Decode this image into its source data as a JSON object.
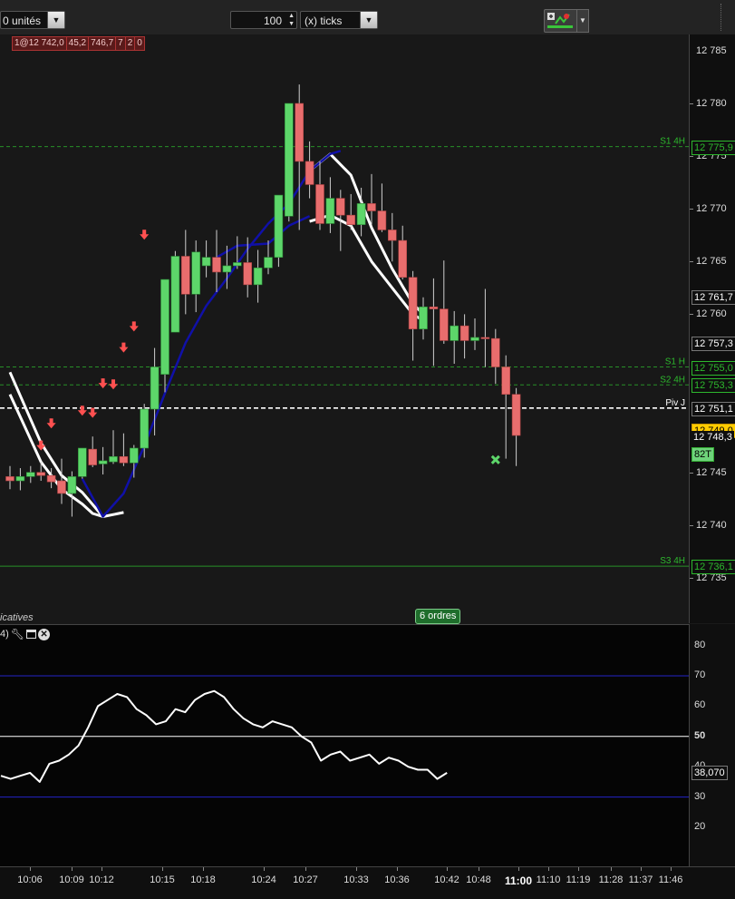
{
  "toolbar": {
    "units_value": "0 unités",
    "ticks_amount": "100",
    "ticks_unit": "(x) ticks"
  },
  "chart": {
    "order_ticket": [
      "1@12 742,0",
      "45,2",
      "746,7",
      "7",
      "2",
      "0"
    ],
    "price_labels": [
      "12 780",
      "12 775",
      "12 770",
      "12 765",
      "12 760",
      "12 745",
      "12 740",
      "12 735"
    ],
    "levels": [
      {
        "label": "S1 4H",
        "value": "12 775,9",
        "color": "#2db82d",
        "style": "dashed"
      },
      {
        "label": "S1 H",
        "value": "12 755,0",
        "color": "#2db82d",
        "style": "dashed"
      },
      {
        "label": "S2 4H",
        "value": "12 753,3",
        "color": "#2db82d",
        "style": "dashed"
      },
      {
        "label": "Piv J",
        "value": "12 751,1",
        "color": "#ffffff",
        "style": "dashed"
      },
      {
        "label": "S3 4H",
        "value": "12 736,1",
        "color": "#2db82d",
        "style": "solid"
      }
    ],
    "top_price": "12 785",
    "high_marker": "12 761,7",
    "mid_marker": "12 757,3",
    "last_price": "12 749,0",
    "last_price_color": "#ffcc00",
    "bid_price": "12 748,3",
    "ticks_badge": "82T",
    "orders_button": "6 ordres",
    "indicators_label": "icatives",
    "candles": [
      [
        0,
        12744.6,
        12745.6,
        12743.4,
        12744.2
      ],
      [
        1,
        12744.2,
        12745.4,
        12743.3,
        12744.6
      ],
      [
        2,
        12744.6,
        12745.6,
        12744.0,
        12745.0
      ],
      [
        3,
        12745.0,
        12746.0,
        12744.2,
        12744.7
      ],
      [
        4,
        12744.7,
        12745.4,
        12743.5,
        12744.1
      ],
      [
        5,
        12744.2,
        12746.3,
        12742.0,
        12743.0
      ],
      [
        6,
        12743.0,
        12745.1,
        12740.8,
        12744.6
      ],
      [
        7,
        12744.6,
        12747.2,
        12744.4,
        12747.3
      ],
      [
        8,
        12747.2,
        12748.4,
        12745.5,
        12745.7
      ],
      [
        9,
        12745.8,
        12747.4,
        12744.8,
        12746.1
      ],
      [
        10,
        12746.0,
        12749.0,
        12745.8,
        12746.5
      ],
      [
        11,
        12746.5,
        12748.7,
        12745.6,
        12745.9
      ],
      [
        12,
        12745.9,
        12747.6,
        12744.5,
        12747.3
      ],
      [
        13,
        12747.3,
        12751.5,
        12746.4,
        12751.0
      ],
      [
        14,
        12751.0,
        12756.8,
        12748.5,
        12755.0
      ],
      [
        15,
        12754.3,
        12763.0,
        12752.6,
        12763.3
      ],
      [
        16,
        12758.3,
        12766.0,
        12758.3,
        12765.5
      ],
      [
        17,
        12765.5,
        12768.0,
        12760.0,
        12761.9
      ],
      [
        18,
        12761.9,
        12767.0,
        12760.2,
        12765.9
      ],
      [
        19,
        12764.6,
        12767.0,
        12763.5,
        12765.4
      ],
      [
        20,
        12765.4,
        12768.0,
        12762.1,
        12764.0
      ],
      [
        21,
        12764.0,
        12766.5,
        12762.4,
        12764.6
      ],
      [
        22,
        12764.6,
        12767.4,
        12764.3,
        12764.9
      ],
      [
        23,
        12764.9,
        12767.3,
        12761.6,
        12762.8
      ],
      [
        24,
        12762.8,
        12766.1,
        12761.1,
        12764.4
      ],
      [
        25,
        12764.4,
        12767.0,
        12763.8,
        12765.4
      ],
      [
        26,
        12765.4,
        12770.0,
        12764.5,
        12771.3
      ],
      [
        27,
        12769.3,
        12775.8,
        12768.8,
        12780.0
      ],
      [
        28,
        12780.0,
        12781.8,
        12768.0,
        12774.5
      ],
      [
        29,
        12774.5,
        12776.4,
        12771.0,
        12772.3
      ],
      [
        30,
        12772.3,
        12774.5,
        12768.0,
        12768.6
      ],
      [
        31,
        12768.6,
        12773.0,
        12767.7,
        12771.0
      ],
      [
        32,
        12771.0,
        12771.8,
        12766.0,
        12769.4
      ],
      [
        33,
        12769.4,
        12771.4,
        12768.0,
        12768.5
      ],
      [
        34,
        12768.5,
        12772.0,
        12767.4,
        12770.5
      ],
      [
        35,
        12770.5,
        12773.3,
        12768.5,
        12769.8
      ],
      [
        36,
        12769.8,
        12772.4,
        12767.8,
        12768.0
      ],
      [
        37,
        12768.0,
        12769.6,
        12765.0,
        12767.0
      ],
      [
        38,
        12767.0,
        12768.4,
        12763.3,
        12763.5
      ],
      [
        39,
        12763.5,
        12764.1,
        12755.6,
        12758.6
      ],
      [
        40,
        12758.6,
        12761.6,
        12757.6,
        12760.7
      ],
      [
        41,
        12760.7,
        12763.4,
        12755.1,
        12760.5
      ],
      [
        42,
        12760.5,
        12765.1,
        12757.2,
        12757.5
      ],
      [
        43,
        12757.5,
        12760.3,
        12755.3,
        12758.9
      ],
      [
        44,
        12758.9,
        12760.0,
        12755.8,
        12757.5
      ],
      [
        45,
        12757.5,
        12759.6,
        12756.6,
        12757.8
      ],
      [
        46,
        12757.8,
        12762.4,
        12755.0,
        12757.7
      ],
      [
        47,
        12757.7,
        12758.6,
        12753.4,
        12755.0
      ],
      [
        48,
        12755.0,
        12756.1,
        12746.3,
        12752.4
      ],
      [
        49,
        12752.4,
        12753.0,
        12745.6,
        12748.5
      ]
    ],
    "arrows": [
      [
        3,
        12747.5
      ],
      [
        4,
        12749.6
      ],
      [
        7,
        12750.8
      ],
      [
        8,
        12750.6
      ],
      [
        9,
        12753.4
      ],
      [
        10,
        12753.3
      ],
      [
        11,
        12756.8
      ],
      [
        12,
        12758.8
      ],
      [
        13,
        12767.5
      ]
    ],
    "ma_blue": [
      [
        7,
        12744.4
      ],
      [
        9,
        12740.8
      ],
      [
        11,
        12743.0
      ],
      [
        13,
        12747.5
      ],
      [
        15,
        12752.5
      ],
      [
        17,
        12757.3
      ],
      [
        19,
        12760.8
      ],
      [
        21,
        12763.4
      ],
      [
        23,
        12766.2
      ],
      [
        25,
        12768.6
      ],
      [
        27,
        12770.5
      ],
      [
        29,
        12773.6
      ],
      [
        31,
        12775.2
      ],
      [
        32,
        12775.5
      ]
    ],
    "ma_blue2": [
      [
        20,
        12765.4
      ],
      [
        22,
        12766.5
      ],
      [
        25,
        12766.7
      ],
      [
        27,
        12768.4
      ],
      [
        29,
        12769.3
      ]
    ],
    "ma_white1": [
      [
        0,
        12754.5
      ],
      [
        3,
        12747.8
      ],
      [
        5,
        12744.7
      ],
      [
        7,
        12743.1
      ],
      [
        9,
        12740.8
      ],
      [
        11,
        12741.2
      ]
    ],
    "ma_white2": [
      [
        0,
        12752.4
      ],
      [
        3,
        12746.0
      ],
      [
        5,
        12743.4
      ],
      [
        7,
        12742.0
      ],
      [
        8,
        12741.1
      ],
      [
        9,
        12740.8
      ]
    ],
    "ma_white3": [
      [
        29,
        12773.6
      ],
      [
        31,
        12775.2
      ],
      [
        33,
        12773.2
      ],
      [
        35,
        12768.2
      ],
      [
        37,
        12764.3
      ],
      [
        39,
        12761.0
      ],
      [
        40,
        12760.0
      ]
    ],
    "ma_white4": [
      [
        29,
        12768.8
      ],
      [
        31,
        12769.4
      ],
      [
        33,
        12768.4
      ],
      [
        35,
        12765.0
      ],
      [
        37,
        12762.5
      ],
      [
        39,
        12760.0
      ],
      [
        40,
        12759.4
      ]
    ],
    "exit_marker": [
      47,
      12746.2
    ]
  },
  "indicator": {
    "label": "4)",
    "levels": [
      "80",
      "70",
      "60",
      "50",
      "40",
      "30",
      "20"
    ],
    "upper": 70,
    "lower": 30,
    "mid": 50,
    "current": "38,070",
    "values": [
      37,
      36,
      37,
      38,
      35,
      41,
      42,
      44,
      47,
      53,
      60,
      62,
      64,
      63,
      59,
      57,
      54,
      55,
      59,
      58,
      62,
      64,
      65,
      63,
      59,
      56,
      54,
      53,
      55,
      54,
      53,
      50,
      48,
      42,
      44,
      45,
      42,
      43,
      44,
      41,
      43,
      42,
      40,
      39,
      39,
      36,
      38
    ]
  },
  "time_axis": {
    "labels": [
      "10:06",
      "10:09",
      "10:12",
      "10:15",
      "10:18",
      "10:24",
      "10:27",
      "10:33",
      "10:36",
      "10:42",
      "10:48",
      "11:00",
      "11:10",
      "11:19",
      "11:28",
      "11:37",
      "11:46"
    ],
    "bold_label": "11:00"
  }
}
